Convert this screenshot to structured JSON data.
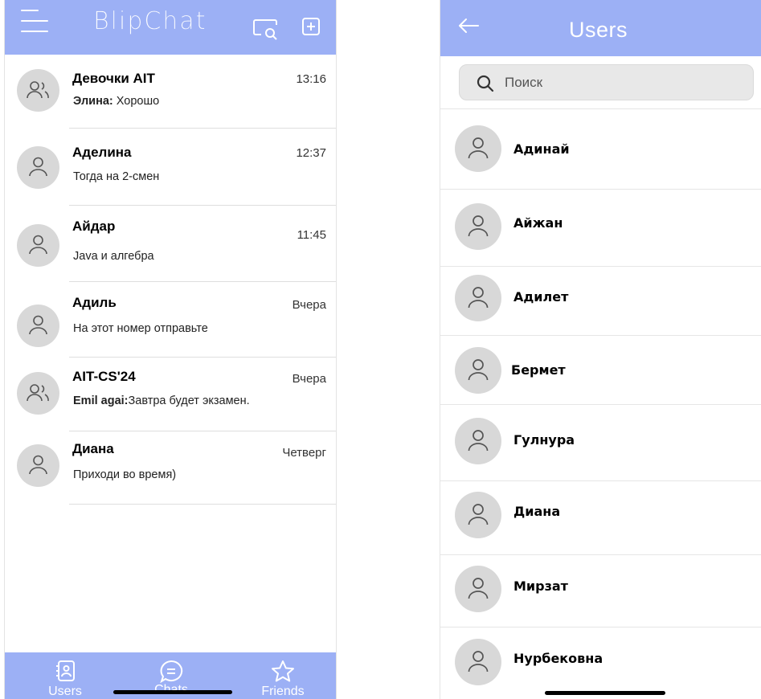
{
  "left_screen": {
    "app_title": "BlipChat",
    "chats": [
      {
        "name": "Девочки AIT",
        "time": "13:16",
        "sender": "Элина: ",
        "message": "Хорошо",
        "group": true
      },
      {
        "name": "Аделина",
        "time": "12:37",
        "sender": "",
        "message": "Тогда на 2-смен",
        "group": false
      },
      {
        "name": "Айдар",
        "time": "11:45",
        "sender": "",
        "message": "Java и алгебра",
        "group": false
      },
      {
        "name": "Адиль",
        "time": "Вчера",
        "sender": "",
        "message": "На этот номер отправьте",
        "group": false
      },
      {
        "name": "AIT-CS'24",
        "time": "Вчера",
        "sender": "Emil agai:",
        "message": "Завтра будет экзамен.",
        "group": true
      },
      {
        "name": "Диана",
        "time": "Четверг",
        "sender": "",
        "message": "Приходи во время)",
        "group": false
      }
    ],
    "tabs": [
      {
        "label": "Users",
        "icon": "contacts-icon"
      },
      {
        "label": "Chats",
        "icon": "chat-bubble-icon"
      },
      {
        "label": "Friends",
        "icon": "star-icon"
      }
    ],
    "colors": {
      "accent": "#9cb0f5",
      "avatar_bg": "#d8d8d8"
    }
  },
  "right_screen": {
    "title": "Users",
    "search_placeholder": "Поиск",
    "users": [
      {
        "name": "Адинай"
      },
      {
        "name": "Айжан"
      },
      {
        "name": "Адилет"
      },
      {
        "name": "Бермет"
      },
      {
        "name": "Гулнура"
      },
      {
        "name": "Диана"
      },
      {
        "name": "Мирзат"
      },
      {
        "name": "Нурбековна"
      }
    ]
  }
}
